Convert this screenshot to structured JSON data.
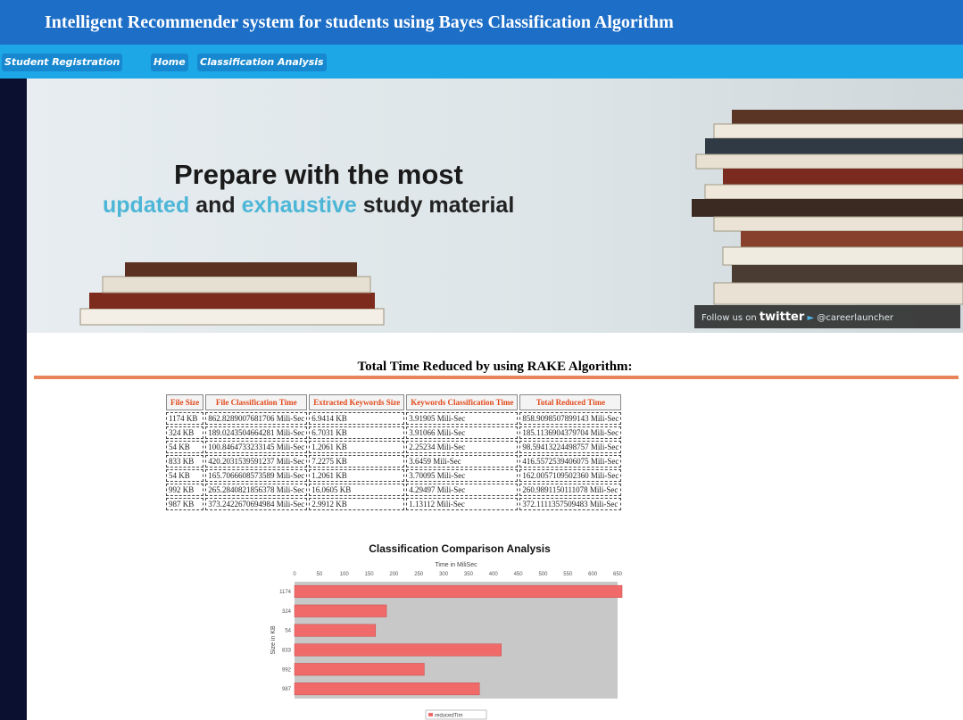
{
  "header": {
    "title": "Intelligent Recommender system for students using Bayes Classification Algorithm"
  },
  "nav": {
    "items": [
      "Student Registration",
      "Home",
      "Classification Analysis"
    ]
  },
  "banner": {
    "line1": "Prepare with the most",
    "line2_hl1": "updated",
    "line2_and": " and ",
    "line2_hl2": "exhaustive",
    "line2_rest": " study material",
    "follow_text": "Follow us on",
    "twitter": "twitter",
    "handle": "@careerlauncher"
  },
  "section": {
    "title": "Total Time Reduced by using RAKE Algorithm:"
  },
  "table": {
    "headers": [
      "File Size",
      "File Classification Time",
      "Extracted Keywords Size",
      "Keywords Classification Time",
      "Total Reduced Time"
    ],
    "rows": [
      [
        "1174 KB",
        "862.8289007681706 Mili-Sec",
        "6.9414 KB",
        "3.91905 Mili-Sec",
        "858.9098507899143 Mili-Sec"
      ],
      [
        "324 KB",
        "189.0243504664281 Mili-Sec",
        "6.7031 KB",
        "3.91066 Mili-Sec",
        "185.1136904379704 Mili-Sec"
      ],
      [
        "54 KB",
        "100.8464733233145 Mili-Sec",
        "1.2061 KB",
        "2.25234 Mili-Sec",
        "98.59413224498757 Mili-Sec"
      ],
      [
        "833 KB",
        "420.2031539591237 Mili-Sec",
        "7.2275 KB",
        "3.6459 Mili-Sec",
        "416.5572539406075 Mili-Sec"
      ],
      [
        "54 KB",
        "165.7066608573589 Mili-Sec",
        "1.2061 KB",
        "3.70095 Mili-Sec",
        "162.0057109502360 Mili-Sec"
      ],
      [
        "992 KB",
        "265.2840821856378 Mili-Sec",
        "16.0605 KB",
        "4.29497 Mili-Sec",
        "260.9891150111078 Mili-Sec"
      ],
      [
        "987 KB",
        "373.2422670694984 Mili-Sec",
        "2.9912 KB",
        "1.13112 Mili-Sec",
        "372.1111357509483 Mili-Sec"
      ]
    ]
  },
  "chart_data": {
    "type": "bar",
    "orientation": "horizontal",
    "title": "Classification Comparison Analysis",
    "xlabel": "Time in MiliSec",
    "ylabel": "Size in KB",
    "xlim": [
      0,
      650
    ],
    "xticks": [
      0,
      50,
      100,
      150,
      200,
      250,
      300,
      350,
      400,
      450,
      500,
      550,
      600,
      650
    ],
    "categories": [
      "1174",
      "324",
      "54",
      "833",
      "992",
      "987"
    ],
    "series": [
      {
        "name": "reducedTim",
        "values": [
          659,
          185,
          163,
          416,
          261,
          372
        ]
      }
    ],
    "legend": "bottom",
    "grid": false,
    "bar_color": "#f06a6a",
    "plot_bg": "#c8c8c8"
  },
  "colors": {
    "titlebar": "#1d6ec7",
    "navbar": "#1ea7e6",
    "divider": "#e9845a",
    "table_header_text": "#e24a1c"
  }
}
